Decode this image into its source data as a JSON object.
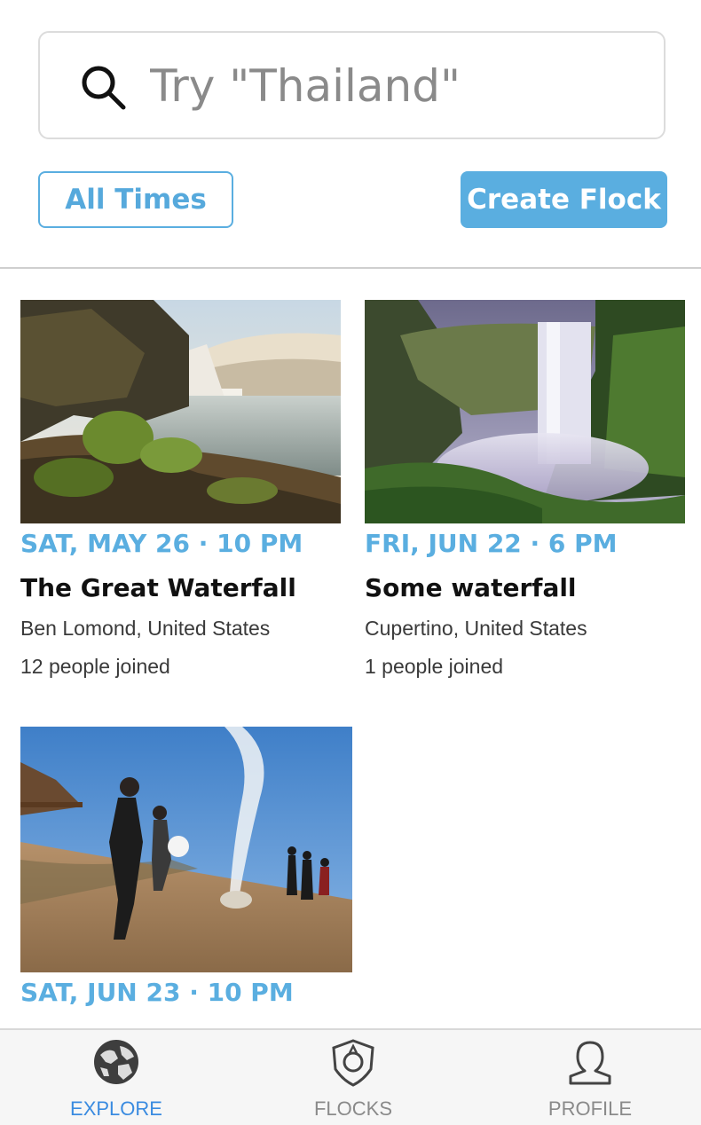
{
  "search": {
    "placeholder": "Try \"Thailand\"",
    "icon": "search-icon"
  },
  "filters": {
    "times_label": "All Times",
    "create_label": "Create Flock"
  },
  "events": [
    {
      "date": "SAT, MAY 26 · 10 PM",
      "title": "The Great Waterfall",
      "location": "Ben Lomond, United States",
      "joined": "12 people joined"
    },
    {
      "date": "FRI, JUN 22 · 6 PM",
      "title": "Some waterfall",
      "location": "Cupertino, United States",
      "joined": "1 people joined"
    },
    {
      "date": "SAT, JUN 23 · 10 PM"
    }
  ],
  "tabs": [
    {
      "label": "EXPLORE",
      "icon": "globe-icon",
      "active": true
    },
    {
      "label": "FLOCKS",
      "icon": "bird-shield-icon",
      "active": false
    },
    {
      "label": "PROFILE",
      "icon": "person-icon",
      "active": false
    }
  ],
  "colors": {
    "accent": "#5aaee0",
    "active_tab": "#3a8be0",
    "inactive_tab": "#8a8a8a"
  }
}
